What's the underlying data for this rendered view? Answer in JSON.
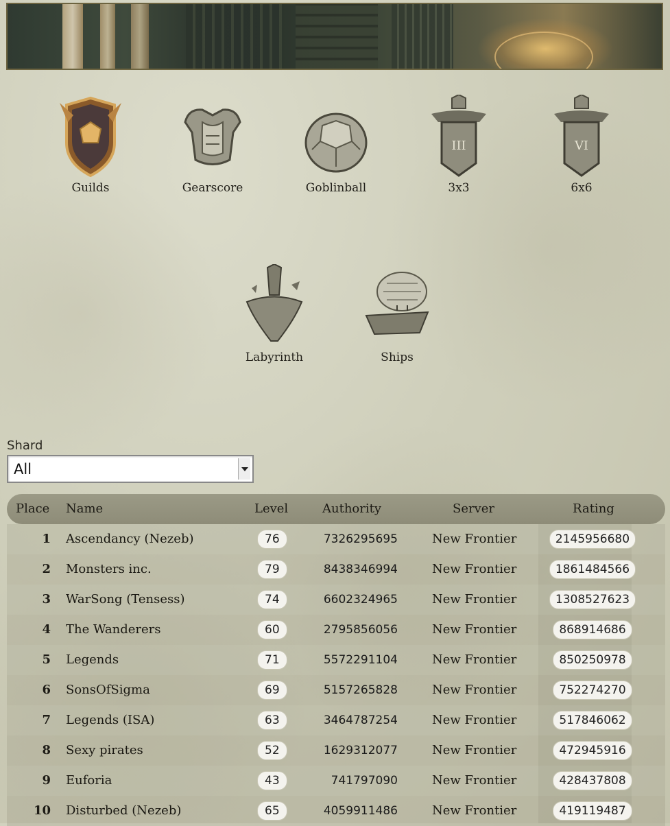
{
  "categories": [
    {
      "label": "Guilds"
    },
    {
      "label": "Gearscore"
    },
    {
      "label": "Goblinball"
    },
    {
      "label": "3x3"
    },
    {
      "label": "6x6"
    },
    {
      "label": "Labyrinth"
    },
    {
      "label": "Ships"
    }
  ],
  "shard": {
    "label": "Shard",
    "selected": "All"
  },
  "table": {
    "headers": {
      "place": "Place",
      "name": "Name",
      "level": "Level",
      "authority": "Authority",
      "server": "Server",
      "rating": "Rating"
    },
    "rows": [
      {
        "place": "1",
        "name": "Ascendancy (Nezeb)",
        "level": "76",
        "authority": "7326295695",
        "server": "New Frontier",
        "rating": "2145956680"
      },
      {
        "place": "2",
        "name": "Monsters inc.",
        "level": "79",
        "authority": "8438346994",
        "server": "New Frontier",
        "rating": "1861484566"
      },
      {
        "place": "3",
        "name": "WarSong (Tensess)",
        "level": "74",
        "authority": "6602324965",
        "server": "New Frontier",
        "rating": "1308527623"
      },
      {
        "place": "4",
        "name": "The Wanderers",
        "level": "60",
        "authority": "2795856056",
        "server": "New Frontier",
        "rating": "868914686"
      },
      {
        "place": "5",
        "name": "Legends",
        "level": "71",
        "authority": "5572291104",
        "server": "New Frontier",
        "rating": "850250978"
      },
      {
        "place": "6",
        "name": "SonsOfSigma",
        "level": "69",
        "authority": "5157265828",
        "server": "New Frontier",
        "rating": "752274270"
      },
      {
        "place": "7",
        "name": "Legends (ISA)",
        "level": "63",
        "authority": "3464787254",
        "server": "New Frontier",
        "rating": "517846062"
      },
      {
        "place": "8",
        "name": "Sexy pirates",
        "level": "52",
        "authority": "1629312077",
        "server": "New Frontier",
        "rating": "472945916"
      },
      {
        "place": "9",
        "name": "Euforia",
        "level": "43",
        "authority": "741797090",
        "server": "New Frontier",
        "rating": "428437808"
      },
      {
        "place": "10",
        "name": "Disturbed (Nezeb)",
        "level": "65",
        "authority": "4059911486",
        "server": "New Frontier",
        "rating": "419119487"
      }
    ]
  }
}
